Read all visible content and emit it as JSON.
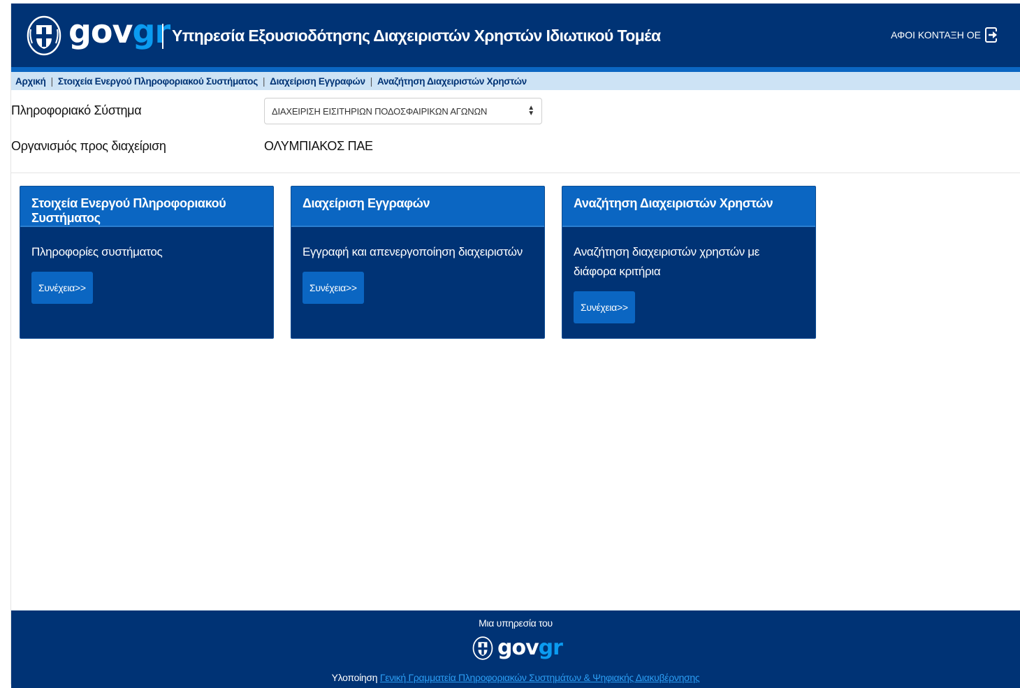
{
  "header": {
    "logo_gov": "gov",
    "logo_gr": "gr",
    "title": "Υπηρεσία Εξουσιοδότησης Διαχειριστών Χρηστών Ιδιωτικού Τομέα",
    "user": "ΑΦΟΙ ΚΟΝΤΑΞΗ ΟΕ",
    "logout_icon": "logout-icon",
    "emblem_icon": "greek-emblem-icon"
  },
  "breadcrumb": {
    "items": [
      "Αρχική",
      "Στοιχεία Ενεργού Πληροφοριακού Συστήματος",
      "Διαχείριση Εγγραφών",
      "Αναζήτηση Διαχειριστών Χρηστών"
    ],
    "separator": "|"
  },
  "form": {
    "system_label": "Πληροφοριακό Σύστημα",
    "system_value": "ΔΙΑΧΕΙΡΙΣΗ ΕΙΣΙΤΗΡΙΩΝ ΠΟΔΟΣΦΑΙΡΙΚΩΝ ΑΓΩΝΩΝ",
    "org_label": "Οργανισμός προς διαχείριση",
    "org_value": "ΟΛΥΜΠΙΑΚΟΣ ΠΑΕ"
  },
  "cards": [
    {
      "title": "Στοιχεία Ενεργού Πληροφοριακού Συστήματος",
      "description": "Πληροφορίες συστήματος",
      "button": "Συνέχεια>>"
    },
    {
      "title": "Διαχείριση Εγγραφών",
      "description": "Εγγραφή και απενεργοποίηση διαχειριστών",
      "button": "Συνέχεια>>"
    },
    {
      "title": "Αναζήτηση Διαχειριστών Χρηστών",
      "description": "Αναζήτηση διαχειριστών χρηστών με διάφορα κριτήρια",
      "button": "Συνέχεια>>"
    }
  ],
  "footer": {
    "service_text": "Μια υπηρεσία του",
    "logo_gov": "gov",
    "logo_gr": "gr",
    "impl_label": "Υλοποίηση",
    "impl_link": "Γενική Γραμματεία Πληροφοριακών Συστημάτων & Ψηφιακής Διακυβέρνησης"
  },
  "colors": {
    "primary_dark": "#003375",
    "primary": "#0b66c2",
    "accent": "#0b9bf0",
    "breadcrumb_bg": "#cde3f5"
  }
}
